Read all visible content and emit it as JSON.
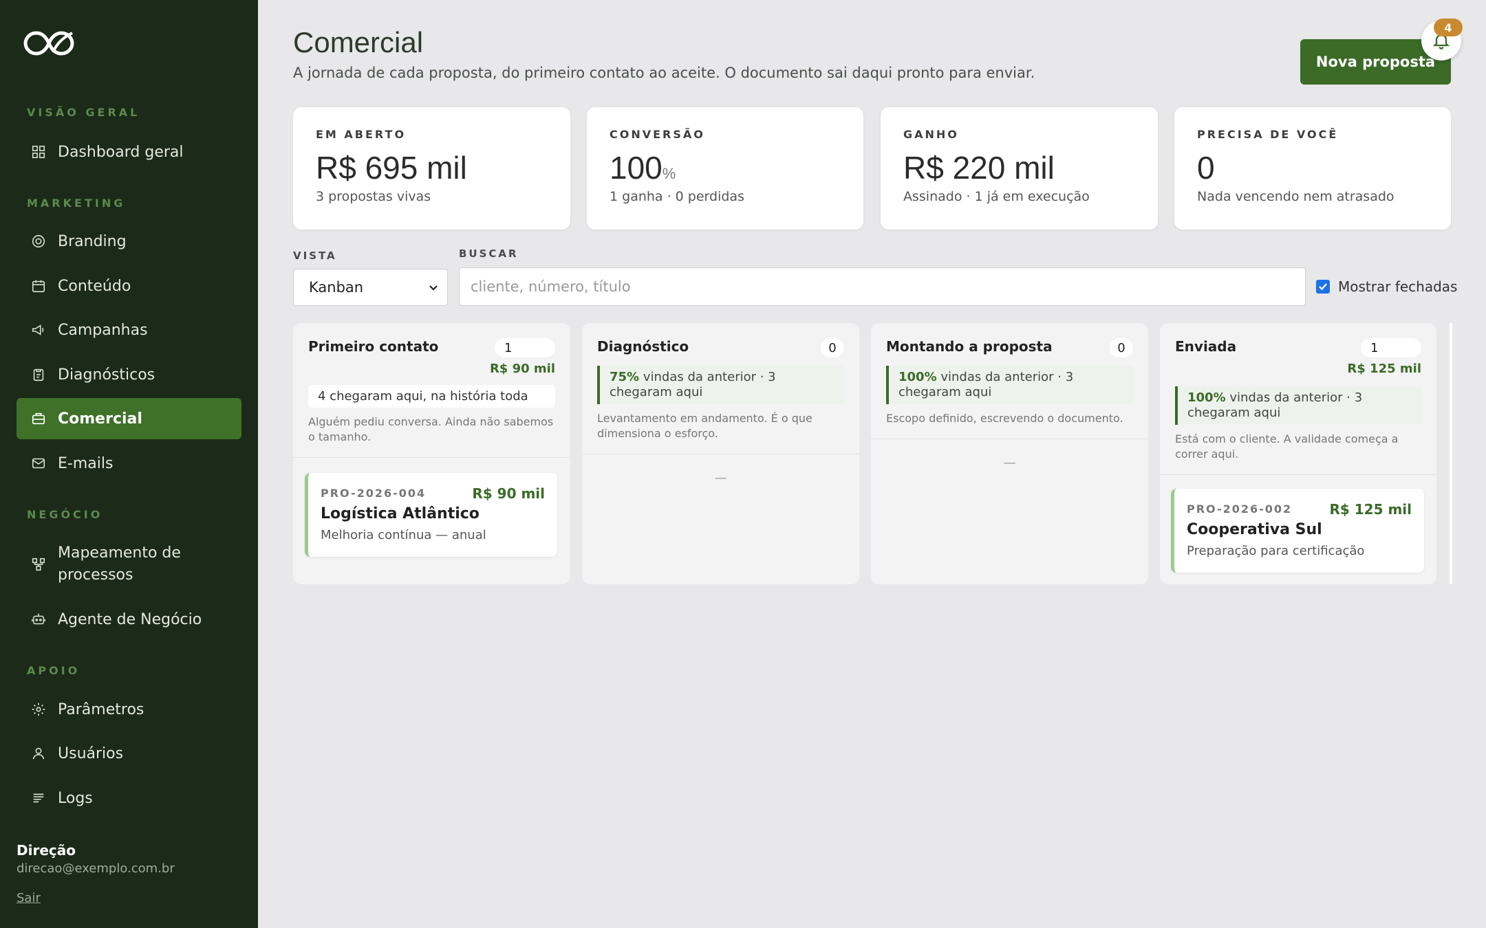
{
  "sidebar": {
    "sections": [
      {
        "title": "VISÃO GERAL"
      },
      {
        "title": "MARKETING"
      },
      {
        "title": "NEGÓCIO"
      },
      {
        "title": "APOIO"
      }
    ],
    "items": [
      {
        "label": "Dashboard geral",
        "icon": "grid-icon"
      },
      {
        "label": "Branding",
        "icon": "target-icon"
      },
      {
        "label": "Conteúdo",
        "icon": "calendar-icon"
      },
      {
        "label": "Campanhas",
        "icon": "megaphone-icon"
      },
      {
        "label": "Diagnósticos",
        "icon": "clipboard-icon"
      },
      {
        "label": "Comercial",
        "icon": "briefcase-icon",
        "active": true
      },
      {
        "label": "E-mails",
        "icon": "mail-icon"
      },
      {
        "label": "Mapeamento de processos",
        "icon": "workflow-icon"
      },
      {
        "label": "Agente de Negócio",
        "icon": "bot-icon"
      },
      {
        "label": "Parâmetros",
        "icon": "settings-icon"
      },
      {
        "label": "Usuários",
        "icon": "users-icon"
      },
      {
        "label": "Logs",
        "icon": "list-icon"
      }
    ],
    "user": {
      "name": "Direção",
      "email": "direcao@exemplo.com.br",
      "logout": "Sair"
    }
  },
  "header": {
    "title": "Comercial",
    "subtitle": "A jornada de cada proposta, do primeiro contato ao aceite. O documento sai daqui pronto para enviar.",
    "new_button": "Nova proposta",
    "notifications": "4"
  },
  "stats": [
    {
      "label": "EM ABERTO",
      "value": "R$ 695 mil",
      "unit": "",
      "desc": "3 propostas vivas"
    },
    {
      "label": "CONVERSÃO",
      "value": "100",
      "unit": "%",
      "desc": "1 ganha · 0 perdidas"
    },
    {
      "label": "GANHO",
      "value": "R$ 220 mil",
      "unit": "",
      "desc": "Assinado · 1 já em execução"
    },
    {
      "label": "PRECISA DE VOCÊ",
      "value": "0",
      "unit": "",
      "desc": "Nada vencendo nem atrasado"
    }
  ],
  "filters": {
    "view_label": "VISTA",
    "view_value": "Kanban",
    "search_label": "BUSCAR",
    "search_placeholder": "cliente, número, título",
    "show_closed": "Mostrar fechadas"
  },
  "columns": [
    {
      "name": "Primeiro contato",
      "count": "1",
      "value": "R$ 90 mil",
      "note": "4 chegaram aqui, na história toda",
      "desc": "Alguém pediu conversa. Ainda não sabemos o tamanho.",
      "card": {
        "code": "PRO-2026-004",
        "value": "R$ 90 mil",
        "title": "Logística Atlântico",
        "sub": "Melhoria contínua — anual"
      }
    },
    {
      "name": "Diagnóstico",
      "count": "0",
      "conv_pct": "75%",
      "conv_text": "vindas da anterior · 3 chegaram aqui",
      "desc": "Levantamento em andamento. É o que dimensiona o esforço.",
      "empty": "—"
    },
    {
      "name": "Montando a proposta",
      "count": "0",
      "conv_pct": "100%",
      "conv_text": "vindas da anterior · 3 chegaram aqui",
      "desc": "Escopo definido, escrevendo o documento.",
      "empty": "—"
    },
    {
      "name": "Enviada",
      "count": "1",
      "value": "R$ 125 mil",
      "conv_pct": "100%",
      "conv_text": "vindas da anterior · 3 chegaram aqui",
      "desc": "Está com o cliente. A validade começa a correr aqui.",
      "card": {
        "code": "PRO-2026-002",
        "value": "R$ 125 mil",
        "title": "Cooperativa Sul",
        "sub": "Preparação para certificação"
      }
    }
  ]
}
